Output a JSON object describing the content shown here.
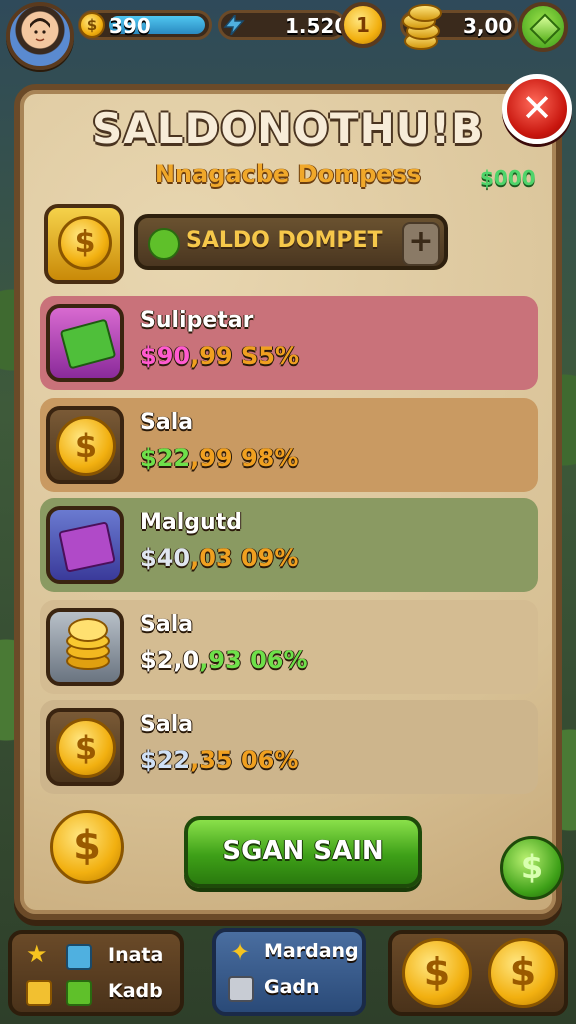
{
  "topbar": {
    "gold_amount": "390",
    "gold_icon_glyph": "$",
    "mid_amount": "1.520",
    "round_coin_value": "1",
    "right_amount": "3,00"
  },
  "panel": {
    "title": "SALDONOTHU!B",
    "subtitle": "Nnagacbe Dompess",
    "balance_tag": "$000",
    "wallet_label": "SALDO DOMPET",
    "wallet_plus": "+",
    "close_glyph": "✕"
  },
  "rows": [
    {
      "name": "Sulipetar",
      "price_a": "$90",
      "price_b": ",99 S5%",
      "color": "#c9727a",
      "price_color": "#ff5ad0",
      "icon": "green-book-icon"
    },
    {
      "name": "Sala",
      "price_a": "$22",
      "price_b": ",99 98%",
      "color": "#c99a62",
      "price_color": "#6ee04a",
      "icon": "gold-coin-icon"
    },
    {
      "name": "Malgutd",
      "price_a": "$40",
      "price_b": ",03 09%",
      "color": "#8a9a62",
      "price_color": "#e0e6f0",
      "icon": "purple-book-icon"
    },
    {
      "name": "Sala",
      "price_a": "$2,0",
      "price_b": ",93 06%",
      "price_b_color": "#6ee04a",
      "color": "#d4bc92",
      "price_color": "#ffffff",
      "icon": "coin-stack-icon"
    },
    {
      "name": "Sala",
      "price_a": "$22",
      "price_b": ",35 06%",
      "color": "#cdb58c",
      "price_color": "#cfe0f6",
      "icon": "gold-coin-icon"
    }
  ],
  "buttons": {
    "main_label": "SGAN SAIN",
    "coin_glyph": "$",
    "green_coin_glyph": "$"
  },
  "bottom": {
    "left_top": "Inata",
    "left_bottom": "Kadb",
    "mid_top": "Mardang",
    "mid_bottom": "Gadn",
    "coin_glyph": "$"
  },
  "colors": {
    "panel": "#d7c094",
    "frame": "#6b4a28",
    "accent_green": "#3ea018",
    "accent_red": "#c8160e",
    "gold": "#f2b010"
  }
}
